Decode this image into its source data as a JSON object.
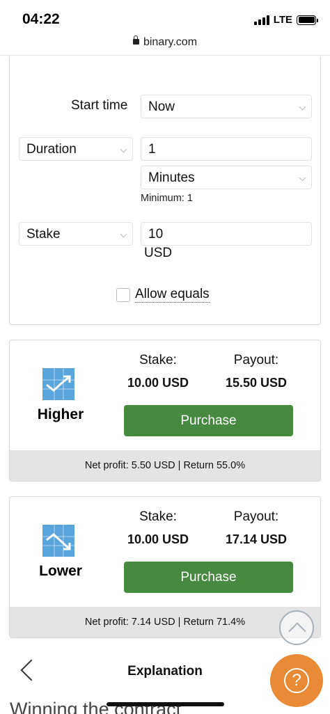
{
  "status_bar": {
    "time": "04:22",
    "network": "LTE"
  },
  "browser": {
    "url": "binary.com"
  },
  "form": {
    "start_time_label": "Start time",
    "start_time_value": "Now",
    "duration_select": "Duration",
    "duration_value": "1",
    "duration_unit": "Minutes",
    "duration_hint": "Minimum: 1",
    "stake_select": "Stake",
    "stake_value": "10",
    "stake_currency": "USD",
    "allow_equals_label": "Allow equals",
    "allow_equals_checked": false
  },
  "contracts": [
    {
      "name": "Higher",
      "icon": "trend-up-icon",
      "stake_label": "Stake:",
      "stake_value": "10.00 USD",
      "payout_label": "Payout:",
      "payout_value": "15.50 USD",
      "button_label": "Purchase",
      "footer": "Net profit: 5.50 USD | Return 55.0%"
    },
    {
      "name": "Lower",
      "icon": "trend-down-icon",
      "stake_label": "Stake:",
      "stake_value": "10.00 USD",
      "payout_label": "Payout:",
      "payout_value": "17.14 USD",
      "button_label": "Purchase",
      "footer": "Net profit: 7.14 USD | Return 71.4%"
    }
  ],
  "bottom": {
    "explanation_title": "Explanation",
    "help_symbol": "?",
    "content_start": "Winning the contract"
  },
  "colors": {
    "purchase_green": "#458a3e",
    "icon_blue": "#5aa5dc",
    "help_orange": "#e98b36",
    "footer_gray": "#e4e4e4"
  }
}
